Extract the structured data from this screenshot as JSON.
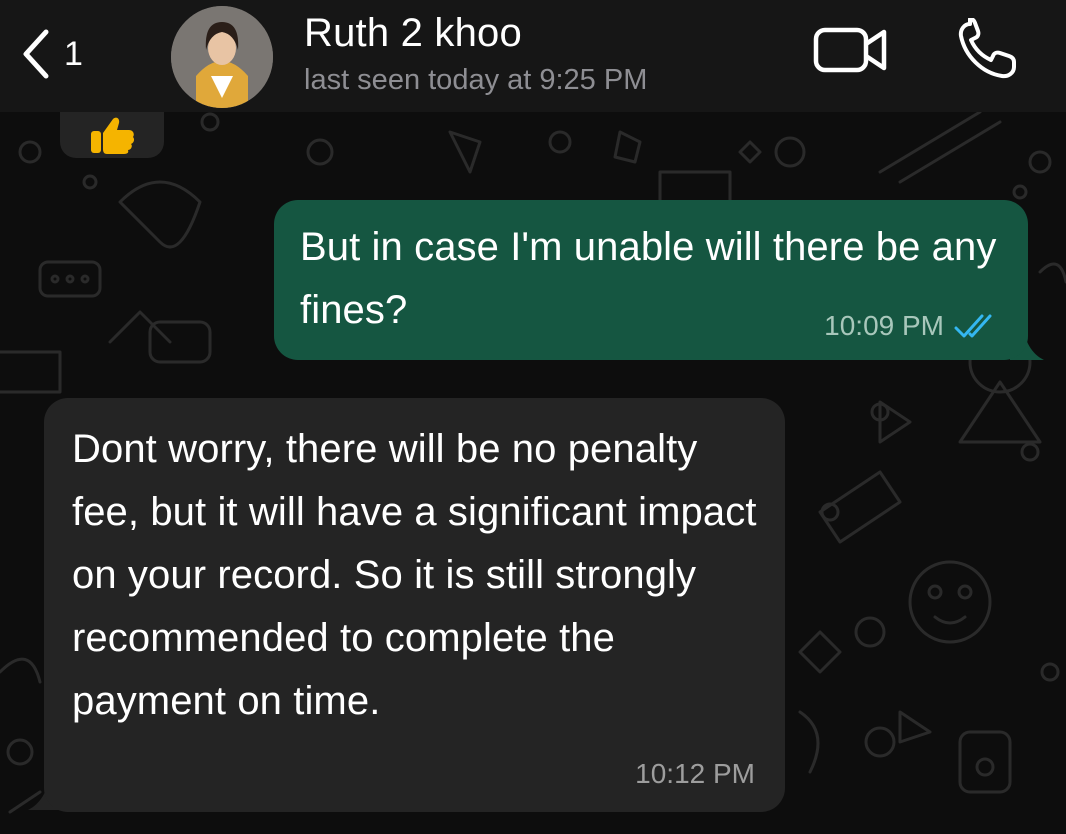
{
  "header": {
    "back_count": "1",
    "contact_name": "Ruth 2 khoo",
    "status": "last seen today at 9:25 PM"
  },
  "messages": [
    {
      "direction": "outgoing",
      "text": "But in case I'm unable will there be any fines?",
      "time": "10:09 PM",
      "read_receipt": "double-check-icon"
    },
    {
      "direction": "incoming",
      "text": "Dont worry, there will be no penalty fee, but it will have a significant impact on your record. So it is still strongly recommended to complete the payment on time.",
      "time": "10:12 PM"
    }
  ],
  "reaction": {
    "icon": "thumbs-up-emoji"
  },
  "colors": {
    "header_bg": "#161616",
    "outgoing_bubble": "#155641",
    "incoming_bubble": "#242424",
    "read_tick": "#34b7f1",
    "chat_bg": "#0d0d0d"
  }
}
